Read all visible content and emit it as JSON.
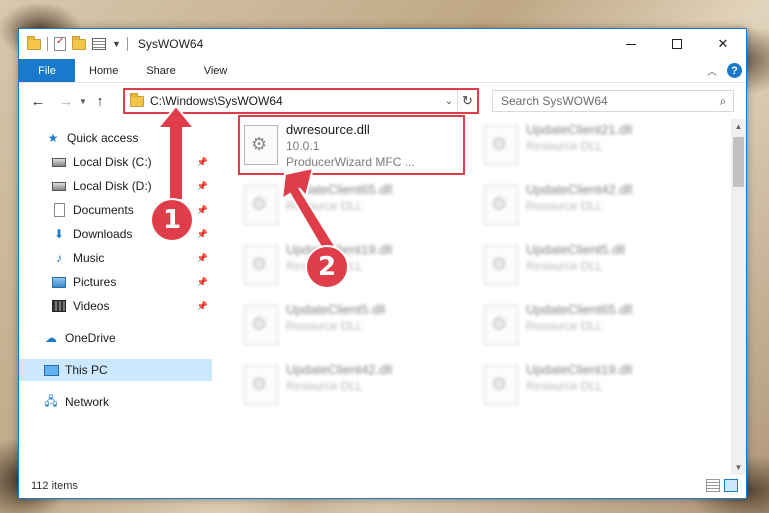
{
  "window": {
    "title": "SysWOW64"
  },
  "ribbon": {
    "tabs": [
      "File",
      "Home",
      "Share",
      "View"
    ],
    "help_label": "?"
  },
  "navbar": {
    "address": "C:\\Windows\\SysWOW64",
    "search_placeholder": "Search SysWOW64"
  },
  "sidebar": {
    "items": [
      {
        "label": "Quick access",
        "icon": "star-icon"
      },
      {
        "label": "Local Disk (C:)",
        "icon": "disk-icon",
        "pinned": true
      },
      {
        "label": "Local Disk (D:)",
        "icon": "disk-icon",
        "pinned": true
      },
      {
        "label": "Documents",
        "icon": "documents-icon",
        "pinned": true
      },
      {
        "label": "Downloads",
        "icon": "download-icon",
        "pinned": true
      },
      {
        "label": "Music",
        "icon": "music-icon",
        "pinned": true
      },
      {
        "label": "Pictures",
        "icon": "pictures-icon",
        "pinned": true
      },
      {
        "label": "Videos",
        "icon": "videos-icon",
        "pinned": true
      },
      {
        "label": "OneDrive",
        "icon": "cloud-icon"
      },
      {
        "label": "This PC",
        "icon": "computer-icon",
        "selected": true
      },
      {
        "label": "Network",
        "icon": "network-icon"
      }
    ]
  },
  "files": [
    {
      "name": "dwresource.dll",
      "line2": "10.0.1",
      "line3": "ProducerWizard MFC ..."
    },
    {
      "name": "UpdateClient21.dll",
      "line2": "Resource DLL"
    },
    {
      "name": "UpdateClient65.dll",
      "line2": "Resource DLL"
    },
    {
      "name": "UpdateClient42.dll",
      "line2": "Resource DLL"
    },
    {
      "name": "UpdateClient19.dll",
      "line2": "Resource DLL"
    },
    {
      "name": "UpdateClient5.dll",
      "line2": "Resource DLL"
    },
    {
      "name": "UpdateClient5.dll",
      "line2": "Resource DLL"
    },
    {
      "name": "UpdateClient65.dll",
      "line2": "Resource DLL"
    },
    {
      "name": "UpdateClient42.dll",
      "line2": "Resource DLL"
    },
    {
      "name": "UpdateClient19.dll",
      "line2": "Resource DLL"
    }
  ],
  "status": {
    "item_count": "112 items"
  },
  "annotations": {
    "badge1": "1",
    "badge2": "2",
    "color": "#e03d4a"
  }
}
